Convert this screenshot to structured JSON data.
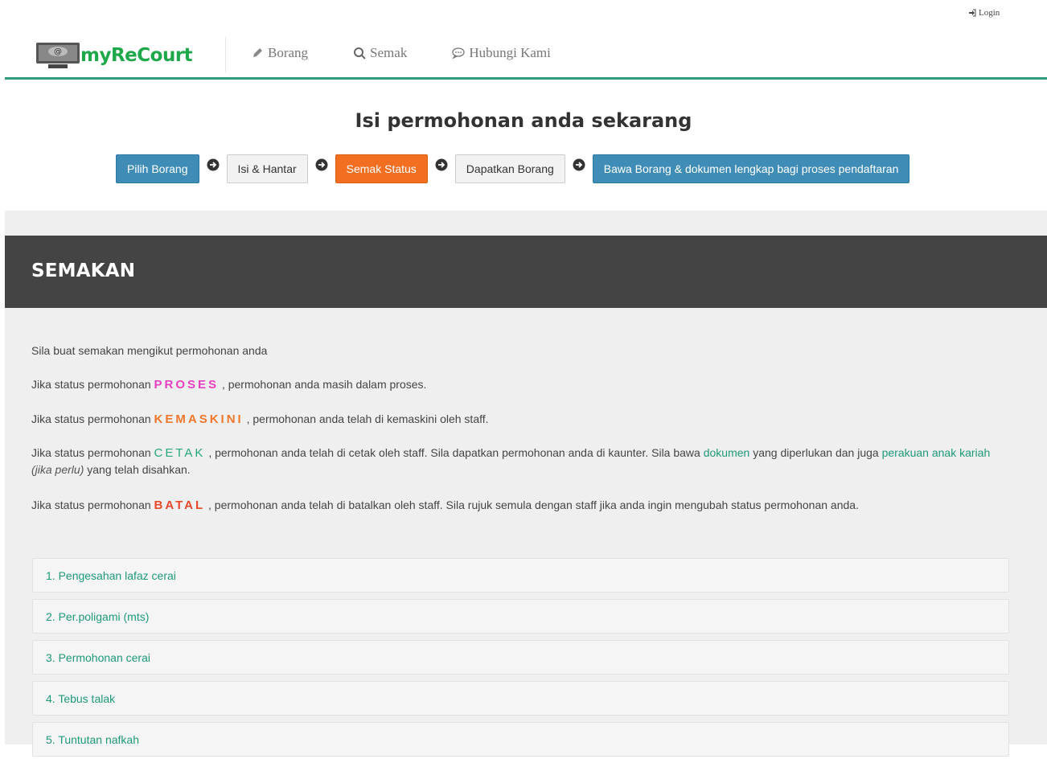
{
  "login": {
    "label": "Login"
  },
  "brand": {
    "name": "myReCourt"
  },
  "nav": [
    {
      "label": "Borang",
      "icon": "pencil-icon"
    },
    {
      "label": "Semak",
      "icon": "search-icon"
    },
    {
      "label": "Hubungi Kami",
      "icon": "comment-icon"
    }
  ],
  "hero": {
    "title": "Isi permohonan anda sekarang",
    "steps": [
      {
        "label": "Pilih Borang",
        "style": "blue"
      },
      {
        "label": "Isi & Hantar",
        "style": "grey"
      },
      {
        "label": "Semak Status",
        "style": "orange"
      },
      {
        "label": "Dapatkan Borang",
        "style": "grey"
      },
      {
        "label": "Bawa Borang & dokumen lengkap bagi proses pendaftaran",
        "style": "blue"
      }
    ]
  },
  "section": {
    "title": "SEMAKAN",
    "intro": "Sila buat semakan mengikut permohonan anda",
    "status_prefix": "Jika status permohonan",
    "proses": {
      "keyword": "PROSES",
      "text": ", permohonan anda masih dalam proses."
    },
    "kemaskini": {
      "keyword": "KEMASKINI",
      "text": ", permohonan anda telah di kemaskini oleh staff."
    },
    "cetak": {
      "keyword": "CETAK",
      "text1": ", permohonan anda telah di cetak oleh staff. Sila dapatkan permohonan anda di kaunter. Sila bawa",
      "link1": "dokumen",
      "text2": "yang diperlukan dan juga",
      "link2": "perakuan anak kariah",
      "italic": "(jika perlu)",
      "text3": "yang telah disahkan."
    },
    "batal": {
      "keyword": "BATAL",
      "text": ", permohonan anda telah di batalkan oleh staff. Sila rujuk semula dengan staff jika anda ingin mengubah status permohonan anda."
    }
  },
  "list": [
    "1. Pengesahan lafaz cerai",
    "2. Per.poligami (mts)",
    "3. Permohonan cerai",
    "4. Tebus talak",
    "5. Tuntutan nafkah"
  ],
  "colors": {
    "accent": "#2f9a7e",
    "step_blue": "#3f8db6",
    "step_orange": "#f26f21",
    "proses": "#e83fc0",
    "kemaskini": "#f2762b",
    "cetak": "#27a77b",
    "batal": "#e8472a"
  }
}
